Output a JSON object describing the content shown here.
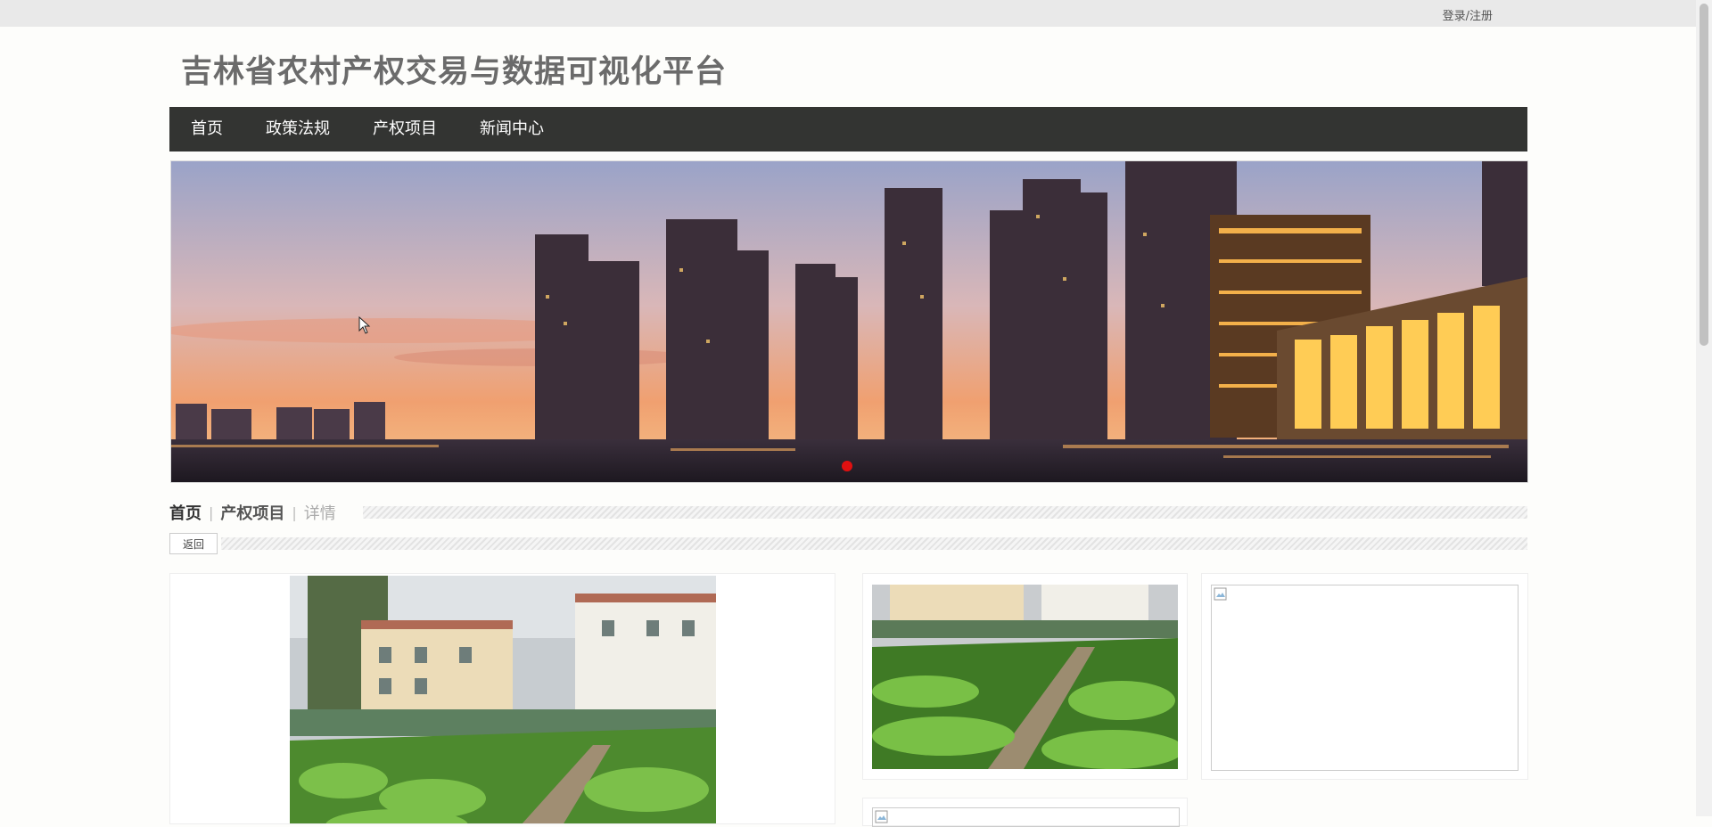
{
  "header": {
    "login_link": "登录/注册",
    "site_title": "吉林省农村产权交易与数据可视化平台"
  },
  "nav": {
    "items": [
      "首页",
      "政策法规",
      "产权项目",
      "新闻中心"
    ]
  },
  "breadcrumb": {
    "items": [
      "首页",
      "产权项目",
      "详情"
    ],
    "separator": "|"
  },
  "back_button": "返回",
  "colors": {
    "nav_bg": "#333432",
    "title": "#6b6b6b",
    "banner_dot_active": "#e01010"
  }
}
